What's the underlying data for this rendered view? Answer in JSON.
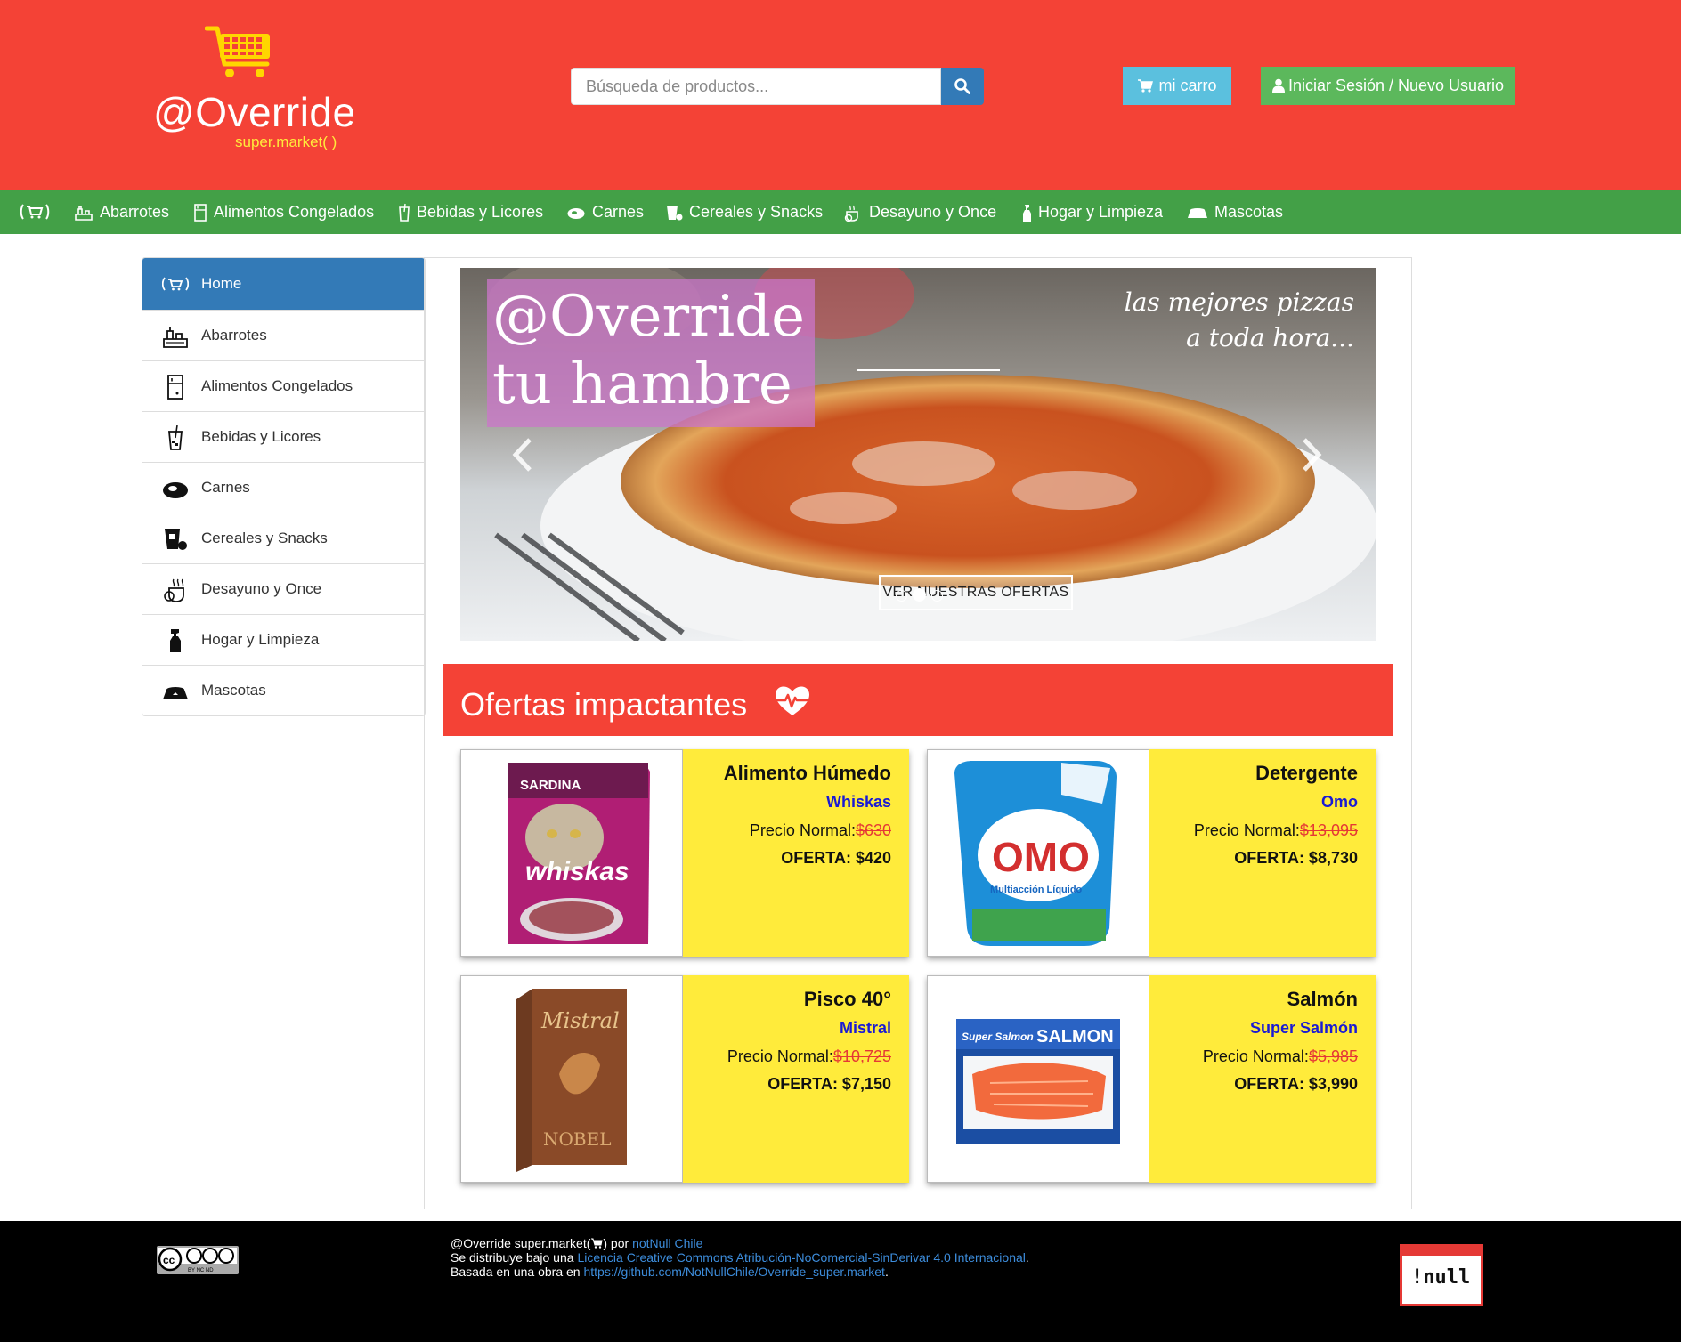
{
  "header": {
    "logo_title": "@Override",
    "logo_subtitle": "super.market( )",
    "search_placeholder": "Búsqueda de productos...",
    "cart_label": "mi carro",
    "login_label": "Iniciar Sesión / Nuevo Usuario"
  },
  "nav": {
    "items": [
      {
        "label": "Abarrotes",
        "icon": "groceries-icon"
      },
      {
        "label": "Alimentos Congelados",
        "icon": "freezer-icon"
      },
      {
        "label": "Bebidas y Licores",
        "icon": "drink-icon"
      },
      {
        "label": "Carnes",
        "icon": "meat-icon"
      },
      {
        "label": "Cereales y Snacks",
        "icon": "snacks-icon"
      },
      {
        "label": "Desayuno y Once",
        "icon": "breakfast-icon"
      },
      {
        "label": "Hogar y Limpieza",
        "icon": "cleaning-icon"
      },
      {
        "label": "Mascotas",
        "icon": "pet-bowl-icon"
      }
    ]
  },
  "sidebar": {
    "items": [
      {
        "label": "Home",
        "icon": "cart-icon",
        "active": true
      },
      {
        "label": "Abarrotes",
        "icon": "groceries-icon"
      },
      {
        "label": "Alimentos Congelados",
        "icon": "freezer-icon"
      },
      {
        "label": "Bebidas y Licores",
        "icon": "drink-icon"
      },
      {
        "label": "Carnes",
        "icon": "meat-icon"
      },
      {
        "label": "Cereales y Snacks",
        "icon": "snacks-icon"
      },
      {
        "label": "Desayuno y Once",
        "icon": "breakfast-icon"
      },
      {
        "label": "Hogar y Limpieza",
        "icon": "cleaning-icon"
      },
      {
        "label": "Mascotas",
        "icon": "pet-bowl-icon"
      }
    ]
  },
  "carousel": {
    "caption_line1": "@Override",
    "caption_line2": "tu hambre",
    "tagline_line1": "las mejores pizzas",
    "tagline_line2": "a toda hora...",
    "button_label": "VER NUESTRAS OFERTAS"
  },
  "offers": {
    "title": "Ofertas impactantes",
    "products": [
      {
        "name": "Alimento Húmedo",
        "brand": "Whiskas",
        "normal_label": "Precio Normal:",
        "normal_price": "$630",
        "offer_label": "OFERTA: $420",
        "image_text": "whiskas",
        "image_sub": "SARDINA"
      },
      {
        "name": "Detergente",
        "brand": "Omo",
        "normal_label": "Precio Normal:",
        "normal_price": "$13,095",
        "offer_label": "OFERTA: $8,730",
        "image_text": "OMO",
        "image_sub": "Multiacción Líquido"
      },
      {
        "name": "Pisco 40°",
        "brand": "Mistral",
        "normal_label": "Precio Normal:",
        "normal_price": "$10,725",
        "offer_label": "OFERTA: $7,150",
        "image_text": "Mistral",
        "image_sub": "NOBEL"
      },
      {
        "name": "Salmón",
        "brand": "Super Salmón",
        "normal_label": "Precio Normal:",
        "normal_price": "$5,985",
        "offer_label": "OFERTA: $3,990",
        "image_text": "SALMON",
        "image_sub": "Super Salmon"
      }
    ]
  },
  "footer": {
    "line1_text": "@Override super.market(",
    "line1_text2": ") por ",
    "line1_link": "notNull Chile",
    "line2_text": "Se distribuye bajo una ",
    "line2_link": "Licencia Creative Commons Atribución-NoComercial-SinDerivar 4.0 Internacional",
    "line2_end": ".",
    "line3_text": "Basada en una obra en ",
    "line3_link": "https://github.com/NotNullChile/Override_super.market",
    "line3_end": ".",
    "cc_sub": "BY   NC   ND",
    "null_logo": "!null"
  },
  "colors": {
    "header_red": "#f44236",
    "nav_green": "#43a047",
    "primary_blue": "#337ab7",
    "info_blue": "#5bc0de",
    "success_green": "#5cb85c",
    "card_yellow": "#ffeb3b"
  }
}
